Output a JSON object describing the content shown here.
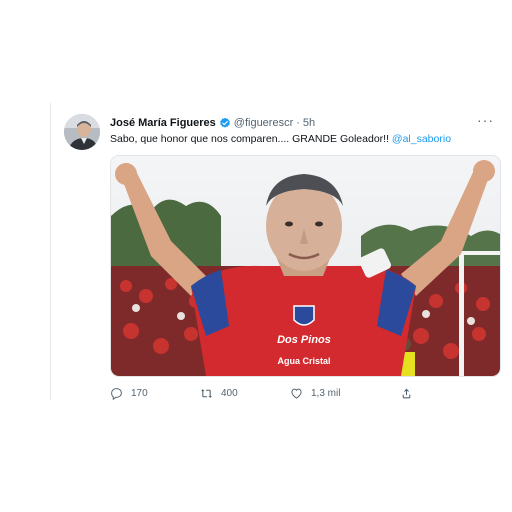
{
  "tweet": {
    "display_name": "José María Figueres",
    "handle": "@figuerescr",
    "separator": "·",
    "time": "5h",
    "text_before": "Sabo, que honor que nos comparen.... GRANDE Goleador!! ",
    "mention": "@al_saborio",
    "more_label": "···"
  },
  "actions": {
    "reply_count": "170",
    "retweet_count": "400",
    "like_count": "1,3 mil"
  },
  "media": {
    "jersey_text_1": "Dos Pinos",
    "jersey_text_2": "Agua Cristal"
  },
  "colors": {
    "accent": "#1d9bf0",
    "jersey_red": "#d32a2f",
    "jersey_blue": "#2b4a9c",
    "text_secondary": "#536471"
  }
}
